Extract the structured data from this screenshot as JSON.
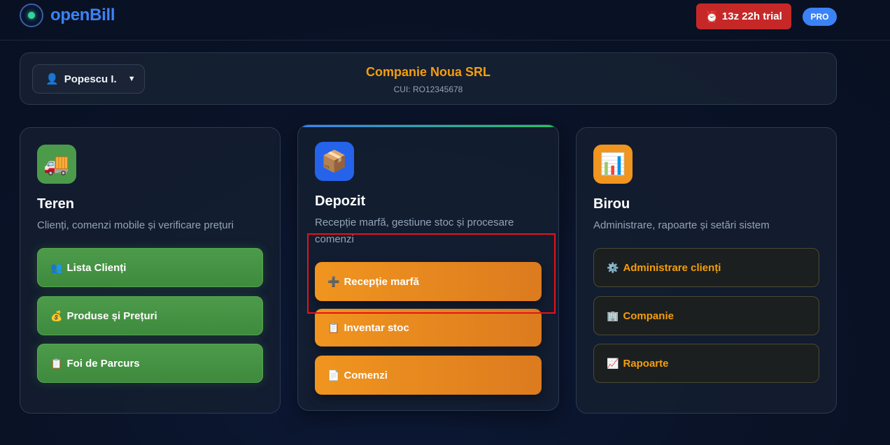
{
  "header": {
    "logo_text": "openBill",
    "trial_icon": "⏰",
    "trial_label": "13z 22h trial",
    "plan_badge": "PRO"
  },
  "company_bar": {
    "user_icon": "👤",
    "user_name": "Popescu I.",
    "caret": "▼",
    "company_name": "Companie Noua SRL",
    "company_cui": "CUI: RO12345678"
  },
  "cards": [
    {
      "icon": "🚚",
      "title": "Teren",
      "description": "Clienți, comenzi mobile și verificare prețuri",
      "buttons": [
        {
          "icon": "👥",
          "label": "Lista Clienți"
        },
        {
          "icon": "💰",
          "label": "Produse și Prețuri"
        },
        {
          "icon": "📋",
          "label": "Foi de Parcurs"
        }
      ]
    },
    {
      "icon": "📦",
      "title": "Depozit",
      "description": "Recepție marfă, gestiune stoc și procesare comenzi",
      "buttons": [
        {
          "icon": "➕",
          "label": "Recepție marfă"
        },
        {
          "icon": "📋",
          "label": "Inventar stoc"
        },
        {
          "icon": "📄",
          "label": "Comenzi"
        }
      ]
    },
    {
      "icon": "📊",
      "title": "Birou",
      "description": "Administrare, rapoarte și setări sistem",
      "buttons": [
        {
          "icon": "⚙️",
          "label": "Administrare clienți"
        },
        {
          "icon": "🏢",
          "label": "Companie"
        },
        {
          "icon": "📈",
          "label": "Rapoarte"
        }
      ]
    }
  ],
  "colors": {
    "brand_blue": "#3b82f6",
    "accent_orange": "#f59e0b",
    "trial_red": "#c62828",
    "teren_green": "#4c9b4a",
    "depozit_blue": "#2563eb",
    "birou_orange": "#f0951f"
  }
}
